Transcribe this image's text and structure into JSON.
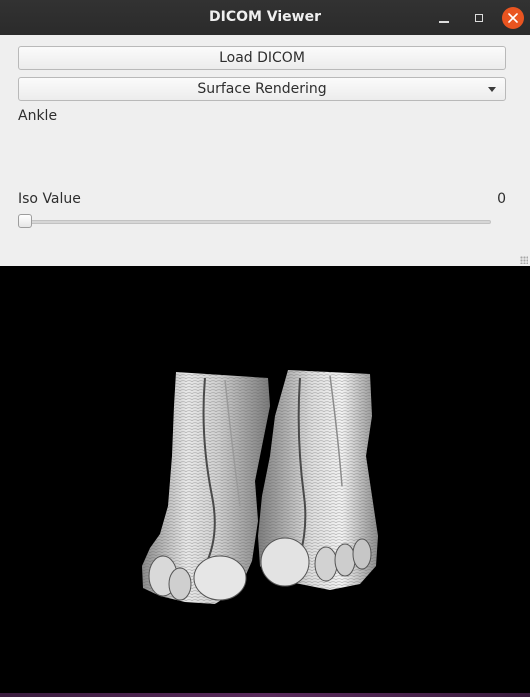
{
  "window": {
    "title": "DICOM Viewer",
    "controls": [
      "minimize-icon",
      "maximize-icon",
      "close-icon"
    ],
    "close_color": "#e95420"
  },
  "panel": {
    "load_button_label": "Load DICOM",
    "render_mode": {
      "selected": "Surface Rendering"
    },
    "region_label": "Ankle",
    "iso": {
      "label": "Iso Value",
      "value": "0",
      "slider_fraction": 0
    }
  },
  "viewport": {
    "background": "#000000",
    "content": "rendered-ct-surface"
  }
}
